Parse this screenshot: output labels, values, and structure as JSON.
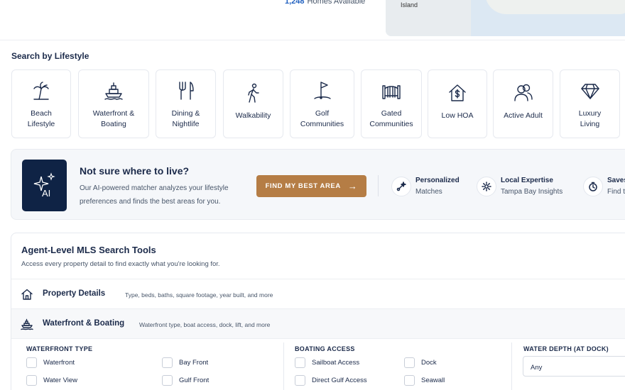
{
  "header": {
    "homes_count": "1,248",
    "homes_label": "Homes Available",
    "map_label": "Island"
  },
  "lifestyle": {
    "title": "Search by Lifestyle",
    "items": [
      {
        "label": "Beach\nLifestyle",
        "icon": "palm-tree-icon"
      },
      {
        "label": "Waterfront &\nBoating",
        "icon": "boat-icon"
      },
      {
        "label": "Dining &\nNightlife",
        "icon": "fork-knife-icon"
      },
      {
        "label": "Walkability",
        "icon": "walking-person-icon"
      },
      {
        "label": "Golf\nCommunities",
        "icon": "golf-flag-icon"
      },
      {
        "label": "Gated\nCommunities",
        "icon": "gate-icon"
      },
      {
        "label": "Low HOA",
        "icon": "house-dollar-icon"
      },
      {
        "label": "Active Adult",
        "icon": "people-icon"
      },
      {
        "label": "Luxury\nLiving",
        "icon": "diamond-icon"
      }
    ]
  },
  "ai": {
    "tile_text": "AI",
    "title": "Not sure where to live?",
    "description": "Our AI-powered matcher analyzes your lifestyle preferences and finds the best areas for you.",
    "button_label": "FIND MY BEST AREA",
    "features": [
      {
        "t1": "Personalized",
        "t2": "Matches",
        "icon": "sparkle-route-icon"
      },
      {
        "t1": "Local Expertise",
        "t2": "Tampa Bay Insights",
        "icon": "gear-badge-icon"
      },
      {
        "t1": "Saves",
        "t2": "Find t",
        "icon": "clock-icon"
      }
    ]
  },
  "mls": {
    "title": "Agent-Level MLS Search Tools",
    "subtitle": "Access every property detail to find exactly what you're looking for.",
    "rows": [
      {
        "title": "Property Details",
        "desc": "Type, beds, baths, square footage, year built, and more"
      },
      {
        "title": "Waterfront & Boating",
        "desc": "Waterfront type, boat access, dock, lift, and more"
      }
    ],
    "panel": {
      "waterfront_type": {
        "heading": "WATERFRONT TYPE",
        "options": [
          "Waterfront",
          "Bay Front",
          "Water View",
          "Gulf Front"
        ]
      },
      "boating_access": {
        "heading": "BOATING ACCESS",
        "options": [
          "Sailboat Access",
          "Dock",
          "Direct Gulf Access",
          "Seawall"
        ]
      },
      "water_depth": {
        "heading": "WATER DEPTH (AT DOCK)",
        "value": "Any"
      }
    }
  },
  "colors": {
    "navy": "#1b2a4a",
    "accent_button": "#b57d45",
    "link_blue": "#1f5fbf",
    "ai_tile": "#0f2345"
  }
}
